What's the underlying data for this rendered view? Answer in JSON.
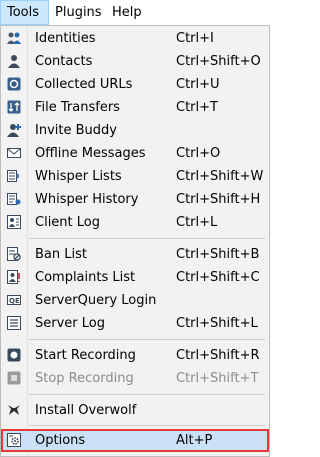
{
  "menubar": {
    "tools": "Tools",
    "plugins": "Plugins",
    "help": "Help"
  },
  "menu": {
    "identities": {
      "label": "Identities",
      "shortcut": "Ctrl+I",
      "icon": "identities-icon"
    },
    "contacts": {
      "label": "Contacts",
      "shortcut": "Ctrl+Shift+O",
      "icon": "contacts-icon"
    },
    "collected_urls": {
      "label": "Collected URLs",
      "shortcut": "Ctrl+U",
      "icon": "url-icon"
    },
    "file_transfers": {
      "label": "File Transfers",
      "shortcut": "Ctrl+T",
      "icon": "file-transfer-icon"
    },
    "invite_buddy": {
      "label": "Invite Buddy",
      "shortcut": "",
      "icon": "invite-buddy-icon"
    },
    "offline_messages": {
      "label": "Offline Messages",
      "shortcut": "Ctrl+O",
      "icon": "envelope-icon"
    },
    "whisper_lists": {
      "label": "Whisper Lists",
      "shortcut": "Ctrl+Shift+W",
      "icon": "whisper-lists-icon"
    },
    "whisper_history": {
      "label": "Whisper History",
      "shortcut": "Ctrl+Shift+H",
      "icon": "whisper-history-icon"
    },
    "client_log": {
      "label": "Client Log",
      "shortcut": "Ctrl+L",
      "icon": "client-log-icon"
    },
    "ban_list": {
      "label": "Ban List",
      "shortcut": "Ctrl+Shift+B",
      "icon": "ban-list-icon"
    },
    "complaints_list": {
      "label": "Complaints List",
      "shortcut": "Ctrl+Shift+C",
      "icon": "complaints-icon"
    },
    "serverquery_login": {
      "label": "ServerQuery Login",
      "shortcut": "",
      "icon": "serverquery-icon"
    },
    "server_log": {
      "label": "Server Log",
      "shortcut": "Ctrl+Shift+L",
      "icon": "server-log-icon"
    },
    "start_recording": {
      "label": "Start Recording",
      "shortcut": "Ctrl+Shift+R",
      "icon": "record-icon"
    },
    "stop_recording": {
      "label": "Stop Recording",
      "shortcut": "Ctrl+Shift+T",
      "icon": "stop-icon"
    },
    "install_overwolf": {
      "label": "Install Overwolf",
      "shortcut": "",
      "icon": "overwolf-icon"
    },
    "options": {
      "label": "Options",
      "shortcut": "Alt+P",
      "icon": "options-icon"
    }
  },
  "colors": {
    "menu_bg": "#f2f2f2",
    "active_menu_bg": "#cce8ff",
    "highlight_bg": "#c9e0f7",
    "highlight_border": "#e53935",
    "disabled_text": "#8c8c8c"
  }
}
